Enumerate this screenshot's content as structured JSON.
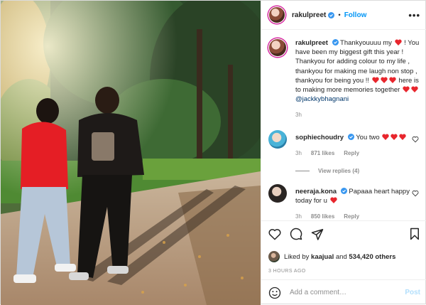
{
  "colors": {
    "accent": "#0095f6",
    "heart": "#ed4956",
    "muted": "#8e8e8e",
    "text": "#262626"
  },
  "header": {
    "username": "rakulpreet",
    "separator": "•",
    "follow_label": "Follow",
    "more_label": "•••"
  },
  "caption": {
    "username": "rakulpreet",
    "text_1": "Thankyouuuu my",
    "text_2": "! You have been my biggest gift this year ! Thankyou for adding colour to my life , thankyou for making me laugh non stop , thankyou for being you !!",
    "text_3": "here is to making more memories together",
    "mention": "@jackkybhagnani",
    "time": "3h"
  },
  "comments": [
    {
      "username": "sophiechoudry",
      "text": "You two",
      "time": "3h",
      "likes": "871 likes",
      "reply_label": "Reply",
      "view_replies": "View replies (4)"
    },
    {
      "username": "neeraja.kona",
      "text": "Papaaa heart happy today for u",
      "time": "3h",
      "likes": "850 likes",
      "reply_label": "Reply"
    }
  ],
  "likes": {
    "prefix": "Liked by",
    "user": "kaajual",
    "joiner": "and",
    "count": "534,420 others"
  },
  "timestamp": "3 HOURS AGO",
  "add_comment": {
    "placeholder": "Add a comment…",
    "post_label": "Post"
  },
  "icons": [
    "heart-icon",
    "comment-icon",
    "share-icon",
    "bookmark-icon",
    "emoji-icon",
    "verified-icon",
    "more-icon"
  ]
}
